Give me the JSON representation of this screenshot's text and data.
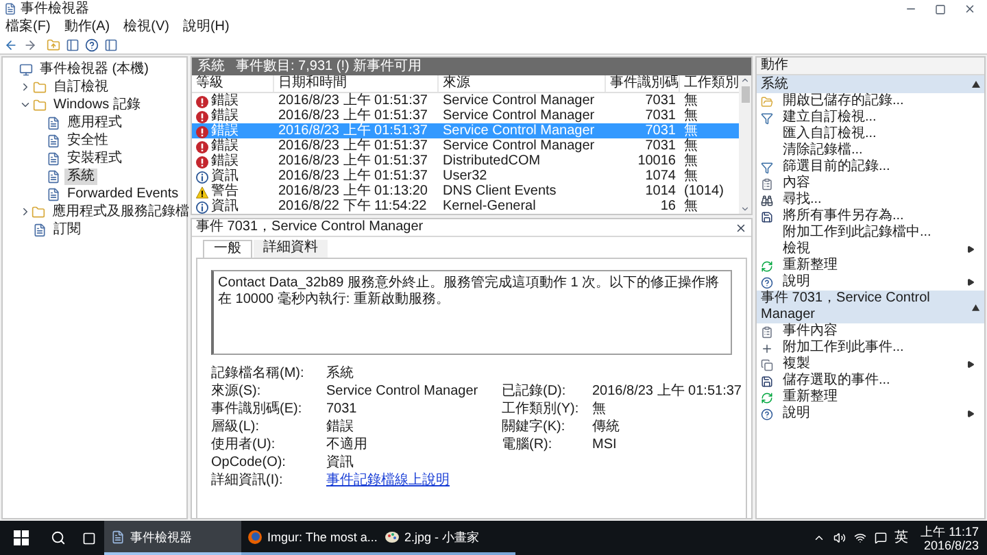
{
  "window": {
    "title": "事件檢視器"
  },
  "menu": [
    "檔案(F)",
    "動作(A)",
    "檢視(V)",
    "說明(H)"
  ],
  "tree": [
    {
      "label": "事件檢視器 (本機)",
      "selected": false,
      "children": [
        {
          "label": "自訂檢視",
          "expanded": false,
          "selected": false
        },
        {
          "label": "Windows 記錄",
          "expanded": true,
          "selected": false,
          "children": [
            {
              "label": "應用程式",
              "selected": false
            },
            {
              "label": "安全性",
              "selected": false
            },
            {
              "label": "安裝程式",
              "selected": false
            },
            {
              "label": "系統",
              "selected": true
            },
            {
              "label": "Forwarded Events",
              "selected": false
            }
          ]
        },
        {
          "label": "應用程式及服務記錄檔",
          "expanded": false,
          "selected": false
        },
        {
          "label": "訂閱",
          "selected": false
        }
      ]
    }
  ],
  "log": {
    "name": "系統",
    "count": "事件數目: 7,931 (!) 新事件可用",
    "columns": [
      "等級",
      "日期和時間",
      "來源",
      "事件識別碼",
      "工作類別"
    ],
    "rows": [
      {
        "kind": "error",
        "level": "錯誤",
        "date": "2016/8/23 上午 01:51:37",
        "source": "Service Control Manager",
        "id": "7031",
        "category": "無",
        "selected": false
      },
      {
        "kind": "error",
        "level": "錯誤",
        "date": "2016/8/23 上午 01:51:37",
        "source": "Service Control Manager",
        "id": "7031",
        "category": "無",
        "selected": false
      },
      {
        "kind": "error",
        "level": "錯誤",
        "date": "2016/8/23 上午 01:51:37",
        "source": "Service Control Manager",
        "id": "7031",
        "category": "無",
        "selected": true
      },
      {
        "kind": "error",
        "level": "錯誤",
        "date": "2016/8/23 上午 01:51:37",
        "source": "Service Control Manager",
        "id": "7031",
        "category": "無",
        "selected": false
      },
      {
        "kind": "error",
        "level": "錯誤",
        "date": "2016/8/23 上午 01:51:37",
        "source": "DistributedCOM",
        "id": "10016",
        "category": "無",
        "selected": false
      },
      {
        "kind": "info",
        "level": "資訊",
        "date": "2016/8/23 上午 01:51:37",
        "source": "User32",
        "id": "1074",
        "category": "無",
        "selected": false
      },
      {
        "kind": "warning",
        "level": "警告",
        "date": "2016/8/23 上午 01:13:20",
        "source": "DNS Client Events",
        "id": "1014",
        "category": "(1014)",
        "selected": false
      },
      {
        "kind": "info",
        "level": "資訊",
        "date": "2016/8/22 下午 11:54:22",
        "source": "Kernel-General",
        "id": "16",
        "category": "無",
        "selected": false
      }
    ]
  },
  "detail": {
    "title": "事件 7031，Service Control Manager",
    "tabs": [
      {
        "label": "一般",
        "selected": true
      },
      {
        "label": "詳細資料",
        "selected": false
      }
    ],
    "message": "Contact Data_32b89 服務意外終止。服務管完成這項動作 1 次。以下的修正操作將在 10000 毫秒內執行: 重新啟動服務。",
    "rows": [
      [
        {
          "kind": "text",
          "label": "記錄檔名稱(M):",
          "value": "系統"
        }
      ],
      [
        {
          "kind": "text",
          "label": "來源(S):",
          "value": "Service Control Manager"
        },
        {
          "kind": "text",
          "label": "已記錄(D):",
          "value": "2016/8/23 上午 01:51:37"
        }
      ],
      [
        {
          "kind": "text",
          "label": "事件識別碼(E):",
          "value": "7031"
        },
        {
          "kind": "text",
          "label": "工作類別(Y):",
          "value": "無"
        }
      ],
      [
        {
          "kind": "text",
          "label": "層級(L):",
          "value": "錯誤"
        },
        {
          "kind": "text",
          "label": "關鍵字(K):",
          "value": "傳統"
        }
      ],
      [
        {
          "kind": "text",
          "label": "使用者(U):",
          "value": "不適用"
        },
        {
          "kind": "text",
          "label": "電腦(R):",
          "value": "MSI"
        }
      ],
      [
        {
          "kind": "text",
          "label": "OpCode(O):",
          "value": "資訊"
        }
      ],
      [
        {
          "kind": "link",
          "label": "詳細資訊(I):",
          "value": "事件記錄檔線上說明"
        }
      ]
    ]
  },
  "actions": {
    "title": "動作",
    "sections": [
      {
        "title": "系統",
        "expanded": true,
        "items": [
          {
            "label": "開啟已儲存的記錄...",
            "submenu": false
          },
          {
            "label": "建立自訂檢視...",
            "submenu": false
          },
          {
            "label": "匯入自訂檢視...",
            "submenu": false
          },
          {
            "label": "清除記錄檔...",
            "submenu": false
          },
          {
            "label": "篩選目前的記錄...",
            "submenu": false
          },
          {
            "label": "內容",
            "submenu": false
          },
          {
            "label": "尋找...",
            "submenu": false
          },
          {
            "label": "將所有事件另存為...",
            "submenu": false
          },
          {
            "label": "附加工作到此記錄檔中...",
            "submenu": false
          },
          {
            "label": "檢視",
            "submenu": true
          },
          {
            "label": "重新整理",
            "submenu": false
          },
          {
            "label": "說明",
            "submenu": true
          }
        ]
      },
      {
        "title": "事件 7031，Service Control Manager",
        "expanded": true,
        "items": [
          {
            "label": "事件內容",
            "submenu": false
          },
          {
            "label": "附加工作到此事件...",
            "submenu": false
          },
          {
            "label": "複製",
            "submenu": true
          },
          {
            "label": "儲存選取的事件...",
            "submenu": false
          },
          {
            "label": "重新整理",
            "submenu": false
          },
          {
            "label": "說明",
            "submenu": true
          }
        ]
      }
    ]
  },
  "taskbar": {
    "apps": [
      {
        "label": "事件檢視器",
        "selected": true
      },
      {
        "label": "Imgur: The most a...",
        "selected": false
      },
      {
        "label": "2.jpg - 小畫家",
        "selected": false
      }
    ],
    "ime": "英",
    "time": "上午 11:17",
    "date": "2016/8/23"
  }
}
